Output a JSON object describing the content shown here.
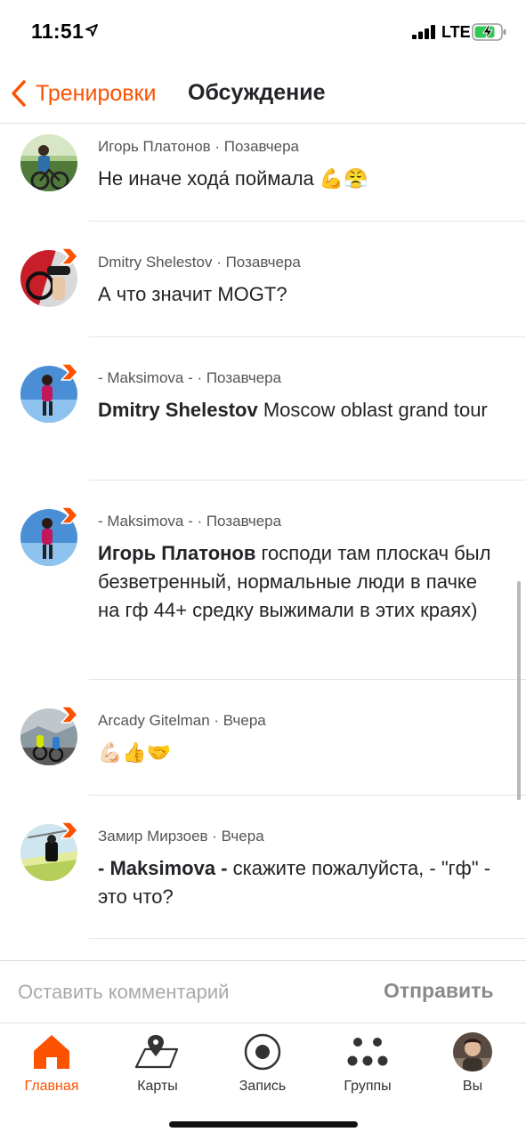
{
  "status": {
    "time": "11:51",
    "network": "LTE"
  },
  "nav": {
    "back_label": "Тренировки",
    "title": "Обсуждение"
  },
  "comments": [
    {
      "author": "Игорь Платонов",
      "time": "Позавчера",
      "meta": "Игорь Платонов · Позавчера",
      "mention": "",
      "text": "Не иначе хода́ поймала 💪😤"
    },
    {
      "author": "Dmitry Shelestov",
      "time": "Позавчера",
      "meta": "Dmitry Shelestov · Позавчера",
      "mention": "",
      "text": " А что значит MOGT?"
    },
    {
      "author": "- Maksimova -",
      "time": "Позавчера",
      "meta": "- Maksimova - · Позавчера",
      "mention": "Dmitry Shelestov",
      "text": " Moscow oblast grand tour"
    },
    {
      "author": "- Maksimova -",
      "time": "Позавчера",
      "meta": "- Maksimova - · Позавчера",
      "mention": "Игорь Платонов",
      "text": " господи там плоскач был безветренный, нормальные люди в пачке на гф 44+ средку выжимали в этих краях)"
    },
    {
      "author": "Arcady Gitelman",
      "time": "Вчера",
      "meta": "Arcady Gitelman · Вчера",
      "mention": "",
      "text": "💪🏻👍🤝"
    },
    {
      "author": "Замир Мирзоев",
      "time": "Вчера",
      "meta": "Замир Мирзоев · Вчера",
      "mention": "- Maksimova -",
      "text": " скажите пожалуйста, - \"гф\" - это что?"
    }
  ],
  "comment_input": {
    "placeholder": "Оставить комментарий",
    "send_label": "Отправить"
  },
  "tabs": [
    {
      "label": "Главная",
      "icon": "home-icon",
      "active": true
    },
    {
      "label": "Карты",
      "icon": "map-icon",
      "active": false
    },
    {
      "label": "Запись",
      "icon": "record-icon",
      "active": false
    },
    {
      "label": "Группы",
      "icon": "groups-icon",
      "active": false
    },
    {
      "label": "Вы",
      "icon": "profile-avatar",
      "active": false
    }
  ],
  "colors": {
    "accent": "#fc5200",
    "text": "#242428",
    "muted": "#555555"
  }
}
